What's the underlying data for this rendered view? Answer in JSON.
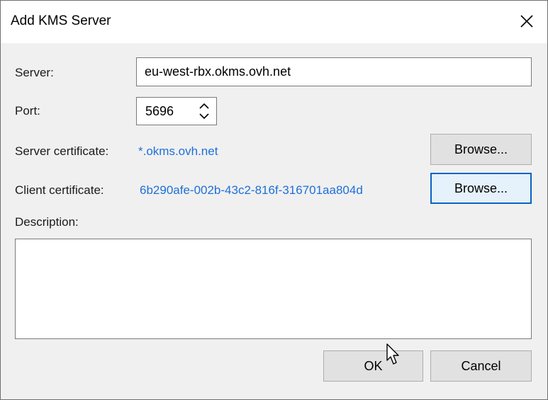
{
  "dialog": {
    "title": "Add KMS Server",
    "close_icon": "close-icon"
  },
  "server": {
    "label": "Server:",
    "value": "eu-west-rbx.okms.ovh.net"
  },
  "port": {
    "label": "Port:",
    "value": "5696",
    "spinner_icon": "spinner-up-down-icon"
  },
  "server_certificate": {
    "label": "Server certificate:",
    "value": "*.okms.ovh.net",
    "browse_label": "Browse..."
  },
  "client_certificate": {
    "label": "Client certificate:",
    "value": "6b290afe-002b-43c2-816f-316701aa804d",
    "browse_label": "Browse..."
  },
  "description": {
    "label": "Description:",
    "value": ""
  },
  "buttons": {
    "ok_label": "OK",
    "cancel_label": "Cancel"
  },
  "colors": {
    "link": "#1e6fd9",
    "focus_border": "#0a62c6",
    "dialog_bg": "#f0f0f0"
  }
}
